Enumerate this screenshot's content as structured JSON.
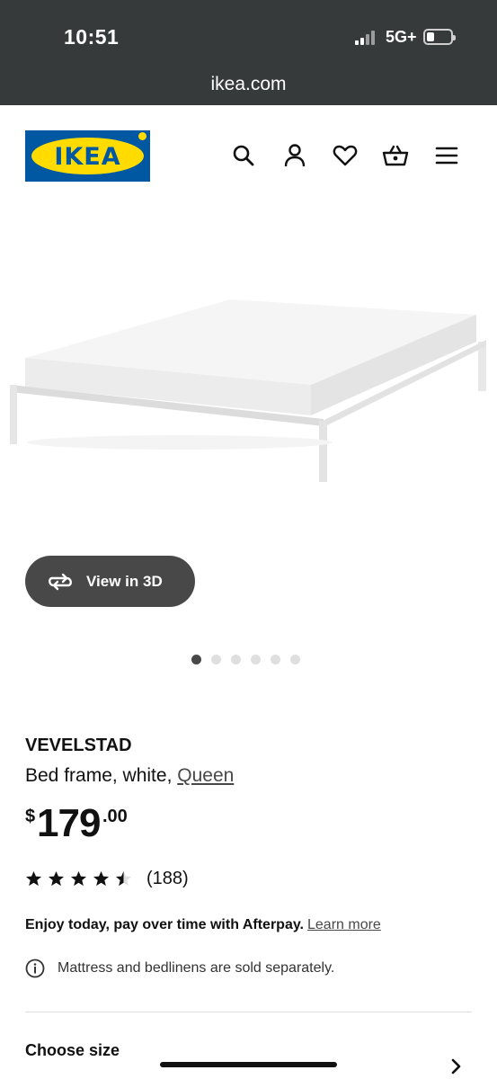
{
  "status_bar": {
    "time": "10:51",
    "network": "5G+"
  },
  "browser": {
    "url": "ikea.com"
  },
  "header": {
    "logo_text": "IKEA",
    "brand_colors": {
      "blue": "#0058a3",
      "yellow": "#ffdb00"
    },
    "icons": [
      "search-icon",
      "account-icon",
      "heart-icon",
      "basket-icon",
      "menu-icon"
    ]
  },
  "gallery": {
    "view_3d_label": "View in 3D",
    "total_images": 6,
    "active_index": 1
  },
  "product": {
    "name": "VEVELSTAD",
    "description": "Bed frame, white, ",
    "size_link": "Queen",
    "price": {
      "currency": "$",
      "whole": "179",
      "decimal": ".00"
    },
    "rating": {
      "stars": 4.5,
      "max": 5,
      "count": "(188)"
    },
    "afterpay_text": "Enjoy today, pay over time with Afterpay.",
    "afterpay_link": "Learn more",
    "notice": "Mattress and bedlinens are sold separately."
  },
  "options": {
    "choose_size": "Choose size"
  }
}
